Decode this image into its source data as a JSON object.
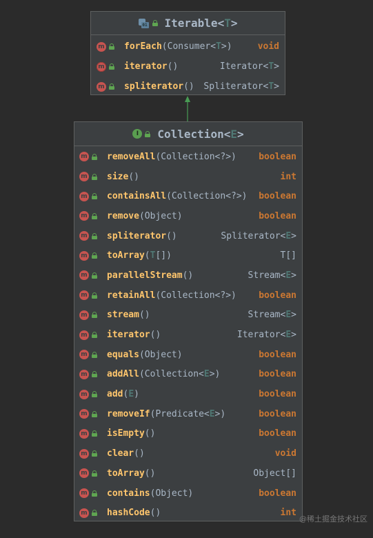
{
  "iterable": {
    "name": "Iterable",
    "generic": "T",
    "methods": [
      {
        "name": "forEach",
        "params": "(Consumer<T>)",
        "returns": "void",
        "ret_kind": "kw"
      },
      {
        "name": "iterator",
        "params": "()",
        "returns": "Iterator<T>",
        "ret_kind": "type"
      },
      {
        "name": "spliterator",
        "params": "()",
        "returns": "Spliterator<T>",
        "ret_kind": "type"
      }
    ]
  },
  "collection": {
    "name": "Collection",
    "generic": "E",
    "methods": [
      {
        "name": "removeAll",
        "params": "(Collection<?>)",
        "returns": "boolean",
        "ret_kind": "kw"
      },
      {
        "name": "size",
        "params": "()",
        "returns": "int",
        "ret_kind": "kw"
      },
      {
        "name": "containsAll",
        "params": "(Collection<?>)",
        "returns": "boolean",
        "ret_kind": "kw"
      },
      {
        "name": "remove",
        "params": "(Object)",
        "returns": "boolean",
        "ret_kind": "kw"
      },
      {
        "name": "spliterator",
        "params": "()",
        "returns": "Spliterator<E>",
        "ret_kind": "type"
      },
      {
        "name": "toArray",
        "params": "(T[])",
        "returns": "T[]",
        "ret_kind": "type"
      },
      {
        "name": "parallelStream",
        "params": "()",
        "returns": "Stream<E>",
        "ret_kind": "type"
      },
      {
        "name": "retainAll",
        "params": "(Collection<?>)",
        "returns": "boolean",
        "ret_kind": "kw"
      },
      {
        "name": "stream",
        "params": "()",
        "returns": "Stream<E>",
        "ret_kind": "type"
      },
      {
        "name": "iterator",
        "params": "()",
        "returns": "Iterator<E>",
        "ret_kind": "type"
      },
      {
        "name": "equals",
        "params": "(Object)",
        "returns": "boolean",
        "ret_kind": "kw"
      },
      {
        "name": "addAll",
        "params": "(Collection<E>)",
        "returns": "boolean",
        "ret_kind": "kw"
      },
      {
        "name": "add",
        "params": "(E)",
        "returns": "boolean",
        "ret_kind": "kw"
      },
      {
        "name": "removeIf",
        "params": "(Predicate<E>)",
        "returns": "boolean",
        "ret_kind": "kw"
      },
      {
        "name": "isEmpty",
        "params": "()",
        "returns": "boolean",
        "ret_kind": "kw"
      },
      {
        "name": "clear",
        "params": "()",
        "returns": "void",
        "ret_kind": "kw"
      },
      {
        "name": "toArray",
        "params": "()",
        "returns": "Object[]",
        "ret_kind": "type"
      },
      {
        "name": "contains",
        "params": "(Object)",
        "returns": "boolean",
        "ret_kind": "kw"
      },
      {
        "name": "hashCode",
        "params": "()",
        "returns": "int",
        "ret_kind": "kw"
      }
    ]
  },
  "watermark": "@稀土掘金技术社区",
  "colors": {
    "background": "#2b2b2b",
    "box": "#3c3f41",
    "border": "#5e6060",
    "method_name": "#ffc66d",
    "keyword": "#cc7832",
    "text": "#a9b7c6",
    "generic": "#507874",
    "method_icon": "#c75450",
    "interface_icon": "#5a9e50",
    "arrow": "#499c54"
  }
}
